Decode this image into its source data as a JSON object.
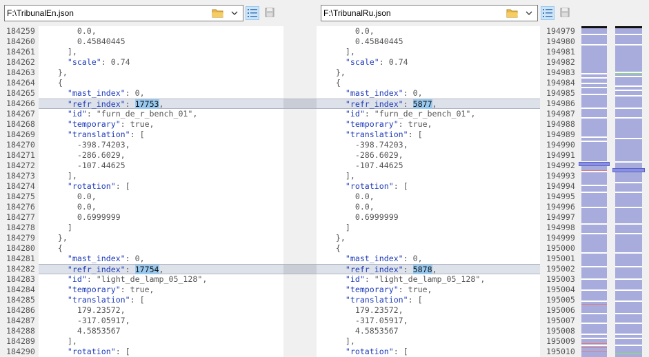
{
  "left": {
    "path": "F:\\TribunalEn.json",
    "lines": [
      {
        "n": "184259",
        "c": [
          [
            "n",
            "        0.0,"
          ]
        ]
      },
      {
        "n": "184260",
        "c": [
          [
            "n",
            "        0.45840445"
          ]
        ]
      },
      {
        "n": "184261",
        "c": [
          [
            "n",
            "      ],"
          ]
        ]
      },
      {
        "n": "184262",
        "c": [
          [
            "n",
            "      "
          ],
          [
            "k",
            "\"scale\""
          ],
          [
            "n",
            ": 0.74"
          ]
        ]
      },
      {
        "n": "184263",
        "c": [
          [
            "n",
            "    },"
          ]
        ]
      },
      {
        "n": "184264",
        "c": [
          [
            "n",
            "    {"
          ]
        ]
      },
      {
        "n": "184265",
        "c": [
          [
            "n",
            "      "
          ],
          [
            "k",
            "\"mast_index\""
          ],
          [
            "n",
            ": 0,"
          ]
        ]
      },
      {
        "n": "184266",
        "c": [
          [
            "n",
            "      "
          ],
          [
            "k",
            "\"refr_index\""
          ],
          [
            "n",
            ": "
          ],
          [
            "sel",
            "17753"
          ],
          [
            "n",
            ","
          ]
        ],
        "hl": true
      },
      {
        "n": "184267",
        "c": [
          [
            "n",
            "      "
          ],
          [
            "k",
            "\"id\""
          ],
          [
            "n",
            ": "
          ],
          [
            "s",
            "\"furn_de_r_bench_01\""
          ],
          [
            "n",
            ","
          ]
        ]
      },
      {
        "n": "184268",
        "c": [
          [
            "n",
            "      "
          ],
          [
            "k",
            "\"temporary\""
          ],
          [
            "n",
            ": true,"
          ]
        ]
      },
      {
        "n": "184269",
        "c": [
          [
            "n",
            "      "
          ],
          [
            "k",
            "\"translation\""
          ],
          [
            "n",
            ": ["
          ]
        ]
      },
      {
        "n": "184270",
        "c": [
          [
            "n",
            "        -398.74203,"
          ]
        ]
      },
      {
        "n": "184271",
        "c": [
          [
            "n",
            "        -286.6029,"
          ]
        ]
      },
      {
        "n": "184272",
        "c": [
          [
            "n",
            "        -107.44625"
          ]
        ]
      },
      {
        "n": "184273",
        "c": [
          [
            "n",
            "      ],"
          ]
        ]
      },
      {
        "n": "184274",
        "c": [
          [
            "n",
            "      "
          ],
          [
            "k",
            "\"rotation\""
          ],
          [
            "n",
            ": ["
          ]
        ]
      },
      {
        "n": "184275",
        "c": [
          [
            "n",
            "        0.0,"
          ]
        ]
      },
      {
        "n": "184276",
        "c": [
          [
            "n",
            "        0.0,"
          ]
        ]
      },
      {
        "n": "184277",
        "c": [
          [
            "n",
            "        0.6999999"
          ]
        ]
      },
      {
        "n": "184278",
        "c": [
          [
            "n",
            "      ]"
          ]
        ]
      },
      {
        "n": "184279",
        "c": [
          [
            "n",
            "    },"
          ]
        ]
      },
      {
        "n": "184280",
        "c": [
          [
            "n",
            "    {"
          ]
        ]
      },
      {
        "n": "184281",
        "c": [
          [
            "n",
            "      "
          ],
          [
            "k",
            "\"mast_index\""
          ],
          [
            "n",
            ": 0,"
          ]
        ]
      },
      {
        "n": "184282",
        "c": [
          [
            "n",
            "      "
          ],
          [
            "k",
            "\"refr_index\""
          ],
          [
            "n",
            ": "
          ],
          [
            "sel",
            "17754"
          ],
          [
            "n",
            ","
          ]
        ],
        "hl": true
      },
      {
        "n": "184283",
        "c": [
          [
            "n",
            "      "
          ],
          [
            "k",
            "\"id\""
          ],
          [
            "n",
            ": "
          ],
          [
            "s",
            "\"light_de_lamp_05_128\""
          ],
          [
            "n",
            ","
          ]
        ]
      },
      {
        "n": "184284",
        "c": [
          [
            "n",
            "      "
          ],
          [
            "k",
            "\"temporary\""
          ],
          [
            "n",
            ": true,"
          ]
        ]
      },
      {
        "n": "184285",
        "c": [
          [
            "n",
            "      "
          ],
          [
            "k",
            "\"translation\""
          ],
          [
            "n",
            ": ["
          ]
        ]
      },
      {
        "n": "184286",
        "c": [
          [
            "n",
            "        179.23572,"
          ]
        ]
      },
      {
        "n": "184287",
        "c": [
          [
            "n",
            "        -317.05917,"
          ]
        ]
      },
      {
        "n": "184288",
        "c": [
          [
            "n",
            "        4.5853567"
          ]
        ]
      },
      {
        "n": "184289",
        "c": [
          [
            "n",
            "      ],"
          ]
        ]
      },
      {
        "n": "184290",
        "c": [
          [
            "n",
            "      "
          ],
          [
            "k",
            "\"rotation\""
          ],
          [
            "n",
            ": ["
          ]
        ]
      }
    ]
  },
  "right": {
    "path": "F:\\TribunalRu.json",
    "lines": [
      {
        "n": "194979",
        "c": [
          [
            "n",
            "        0.0,"
          ]
        ]
      },
      {
        "n": "194980",
        "c": [
          [
            "n",
            "        0.45840445"
          ]
        ]
      },
      {
        "n": "194981",
        "c": [
          [
            "n",
            "      ],"
          ]
        ]
      },
      {
        "n": "194982",
        "c": [
          [
            "n",
            "      "
          ],
          [
            "k",
            "\"scale\""
          ],
          [
            "n",
            ": 0.74"
          ]
        ]
      },
      {
        "n": "194983",
        "c": [
          [
            "n",
            "    },"
          ]
        ]
      },
      {
        "n": "194984",
        "c": [
          [
            "n",
            "    {"
          ]
        ]
      },
      {
        "n": "194985",
        "c": [
          [
            "n",
            "      "
          ],
          [
            "k",
            "\"mast_index\""
          ],
          [
            "n",
            ": 0,"
          ]
        ]
      },
      {
        "n": "194986",
        "c": [
          [
            "n",
            "      "
          ],
          [
            "k",
            "\"refr_index\""
          ],
          [
            "n",
            ": "
          ],
          [
            "sel",
            "5877"
          ],
          [
            "n",
            ","
          ]
        ],
        "hl": true
      },
      {
        "n": "194987",
        "c": [
          [
            "n",
            "      "
          ],
          [
            "k",
            "\"id\""
          ],
          [
            "n",
            ": "
          ],
          [
            "s",
            "\"furn_de_r_bench_01\""
          ],
          [
            "n",
            ","
          ]
        ]
      },
      {
        "n": "194988",
        "c": [
          [
            "n",
            "      "
          ],
          [
            "k",
            "\"temporary\""
          ],
          [
            "n",
            ": true,"
          ]
        ]
      },
      {
        "n": "194989",
        "c": [
          [
            "n",
            "      "
          ],
          [
            "k",
            "\"translation\""
          ],
          [
            "n",
            ": ["
          ]
        ]
      },
      {
        "n": "194990",
        "c": [
          [
            "n",
            "        -398.74203,"
          ]
        ]
      },
      {
        "n": "194991",
        "c": [
          [
            "n",
            "        -286.6029,"
          ]
        ]
      },
      {
        "n": "194992",
        "c": [
          [
            "n",
            "        -107.44625"
          ]
        ]
      },
      {
        "n": "194993",
        "c": [
          [
            "n",
            "      ],"
          ]
        ]
      },
      {
        "n": "194994",
        "c": [
          [
            "n",
            "      "
          ],
          [
            "k",
            "\"rotation\""
          ],
          [
            "n",
            ": ["
          ]
        ]
      },
      {
        "n": "194995",
        "c": [
          [
            "n",
            "        0.0,"
          ]
        ]
      },
      {
        "n": "194996",
        "c": [
          [
            "n",
            "        0.0,"
          ]
        ]
      },
      {
        "n": "194997",
        "c": [
          [
            "n",
            "        0.6999999"
          ]
        ]
      },
      {
        "n": "194998",
        "c": [
          [
            "n",
            "      ]"
          ]
        ]
      },
      {
        "n": "194999",
        "c": [
          [
            "n",
            "    },"
          ]
        ]
      },
      {
        "n": "195000",
        "c": [
          [
            "n",
            "    {"
          ]
        ]
      },
      {
        "n": "195001",
        "c": [
          [
            "n",
            "      "
          ],
          [
            "k",
            "\"mast_index\""
          ],
          [
            "n",
            ": 0,"
          ]
        ]
      },
      {
        "n": "195002",
        "c": [
          [
            "n",
            "      "
          ],
          [
            "k",
            "\"refr_index\""
          ],
          [
            "n",
            ": "
          ],
          [
            "sel",
            "5878"
          ],
          [
            "n",
            ","
          ]
        ],
        "hl": true
      },
      {
        "n": "195003",
        "c": [
          [
            "n",
            "      "
          ],
          [
            "k",
            "\"id\""
          ],
          [
            "n",
            ": "
          ],
          [
            "s",
            "\"light_de_lamp_05_128\""
          ],
          [
            "n",
            ","
          ]
        ]
      },
      {
        "n": "195004",
        "c": [
          [
            "n",
            "      "
          ],
          [
            "k",
            "\"temporary\""
          ],
          [
            "n",
            ": true,"
          ]
        ]
      },
      {
        "n": "195005",
        "c": [
          [
            "n",
            "      "
          ],
          [
            "k",
            "\"translation\""
          ],
          [
            "n",
            ": ["
          ]
        ]
      },
      {
        "n": "195006",
        "c": [
          [
            "n",
            "        179.23572,"
          ]
        ]
      },
      {
        "n": "195007",
        "c": [
          [
            "n",
            "        -317.05917,"
          ]
        ]
      },
      {
        "n": "195008",
        "c": [
          [
            "n",
            "        4.5853567"
          ]
        ]
      },
      {
        "n": "195009",
        "c": [
          [
            "n",
            "      ],"
          ]
        ]
      },
      {
        "n": "195010",
        "c": [
          [
            "n",
            "      "
          ],
          [
            "k",
            "\"rotation\""
          ],
          [
            "n",
            ": ["
          ]
        ]
      }
    ]
  },
  "icons": {
    "open_folder": "folder-icon",
    "dropdown": "chevron-down-icon",
    "line_numbers_toggle": "line-numbers-icon",
    "save": "save-icon"
  },
  "colors": {
    "keyword": "#1d3bb8",
    "selection": "#99c9ef",
    "diff_line": "#dde2ea",
    "minimap": "#a8acdc"
  }
}
